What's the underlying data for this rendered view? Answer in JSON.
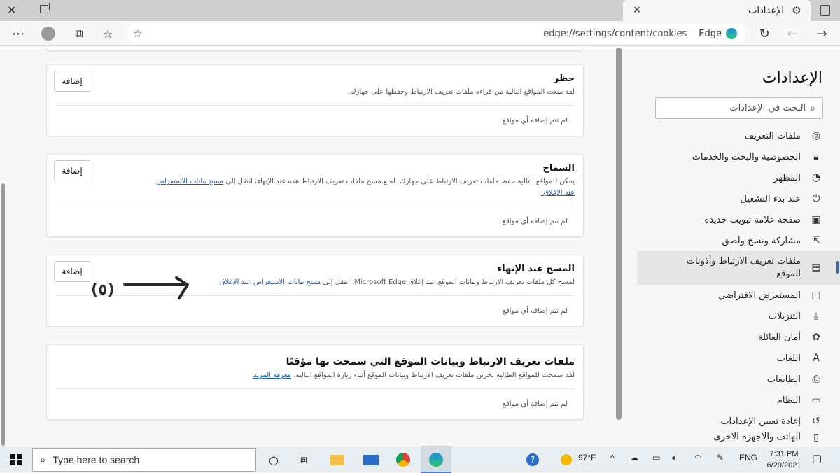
{
  "window": {
    "tab_title": "الإعدادات",
    "url": "edge://settings/content/cookies",
    "brand": "Edge"
  },
  "sidebar": {
    "title": "الإعدادات",
    "search_placeholder": "البحث في الإعدادات",
    "items": [
      {
        "label": "ملفات التعريف",
        "icon": "profile-icon"
      },
      {
        "label": "الخصوصية والبحث والخدمات",
        "icon": "lock-icon"
      },
      {
        "label": "المظهر",
        "icon": "palette-icon"
      },
      {
        "label": "عند بدء التشغيل",
        "icon": "power-icon"
      },
      {
        "label": "صفحة علامة تبويب جديدة",
        "icon": "newtab-icon"
      },
      {
        "label": "مشاركة ونسخ ولصق",
        "icon": "share-icon"
      },
      {
        "label": "ملفات تعريف الارتباط وأذونات الموقع",
        "icon": "site-permissions-icon",
        "active": true
      },
      {
        "label": "المستعرض الافتراضي",
        "icon": "browser-icon"
      },
      {
        "label": "التنزيلات",
        "icon": "download-icon"
      },
      {
        "label": "أمان العائلة",
        "icon": "family-icon"
      },
      {
        "label": "اللغات",
        "icon": "language-icon"
      },
      {
        "label": "الطابعات",
        "icon": "printer-icon"
      },
      {
        "label": "النظام",
        "icon": "system-icon"
      },
      {
        "label": "إعادة تعيين الإعدادات",
        "icon": "reset-icon"
      },
      {
        "label": "الهاتف والأجهزة الأخرى",
        "icon": "phone-icon"
      }
    ]
  },
  "cards": {
    "block": {
      "title": "حظر",
      "desc": "لقد منعت المواقع التالية من قراءة ملفات تعريف الارتباط وحفظها على جهازك.",
      "add": "إضافة",
      "empty": "لم تتم إضافة أي مواقع"
    },
    "allow": {
      "title": "السماح",
      "desc": "يمكن للمواقع التالية حفظ ملفات تعريف الارتباط على جهازك. لمنع مسح ملفات تعريف الارتباط هذه عند الإنهاء، انتقل إلى",
      "link": "مسح بيانات الاستعراض عند الإغلاق.",
      "add": "إضافة",
      "empty": "لم تتم إضافة أي مواقع"
    },
    "clear_on_exit": {
      "title": "المسح عند الإنهاء",
      "desc": "لمسح كل ملفات تعريف الارتباط وبيانات الموقع عند إغلاق Microsoft Edge، انتقل إلى",
      "link": "مسح بيانات الاستعراض عند الإغلاق",
      "add": "إضافة",
      "empty": "لم تتم إضافة أي مواقع"
    },
    "temporary": {
      "title": "ملفات تعريف الارتباط وبيانات الموقع التي سمحت بها مؤقتًا",
      "desc": "لقد سمحت للمواقع الطالبة تخزين ملفات تعريف الارتباط وبيانات الموقع أثناء زيارة المواقع التالية.",
      "link": "معرفة المزيد",
      "empty": "لم تتم إضافة أي مواقع"
    }
  },
  "annotation": {
    "text": "(٥)"
  },
  "taskbar": {
    "search_placeholder": "Type here to search",
    "temperature": "97°F",
    "language": "ENG",
    "time": "7:31 PM",
    "date": "6/29/2021"
  }
}
